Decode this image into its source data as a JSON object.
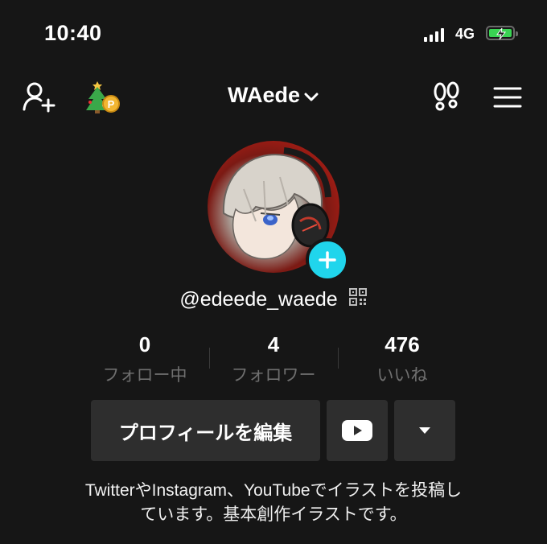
{
  "status_bar": {
    "time": "10:40",
    "network": "4G",
    "battery_level": 1.0,
    "battery_color": "#39d353"
  },
  "header": {
    "username": "WAede",
    "icons": [
      "add-user-icon",
      "tree-coin-icon",
      "footprints-icon",
      "menu-icon"
    ]
  },
  "profile": {
    "handle": "@edeede_waede",
    "accent": "#20d5ec"
  },
  "stats": [
    {
      "value": "0",
      "label": "フォロー中"
    },
    {
      "value": "4",
      "label": "フォロワー"
    },
    {
      "value": "476",
      "label": "いいね"
    }
  ],
  "actions": {
    "edit_label": "プロフィールを編集"
  },
  "bio": {
    "line1": "TwitterやInstagram、YouTubeでイラストを投稿し",
    "line2": "ています。基本創作イラストです。"
  }
}
